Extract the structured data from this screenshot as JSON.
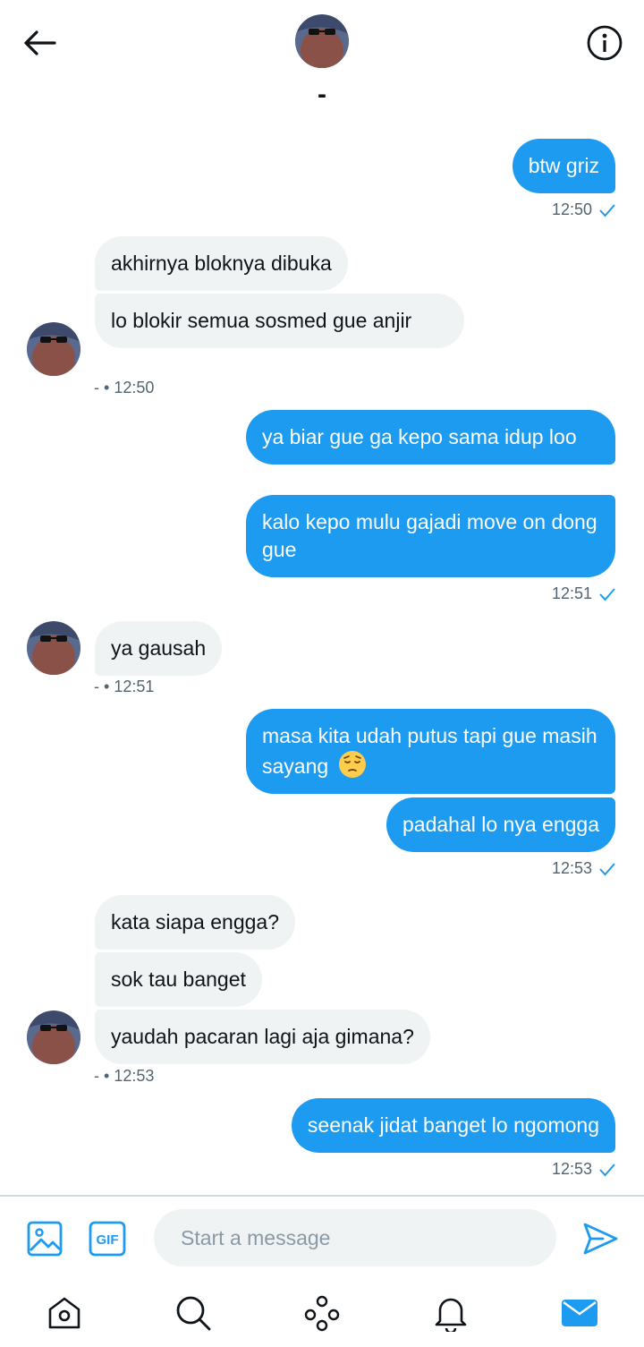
{
  "header": {
    "title": "-",
    "back_icon": "arrow-left-icon",
    "info_icon": "info-icon"
  },
  "colors": {
    "accent": "#1d9bf0",
    "incoming_bubble": "#eff3f4",
    "meta_text": "#536471"
  },
  "messages": [
    {
      "dir": "out",
      "text": "btw griz"
    },
    {
      "dir": "out_meta",
      "time": "12:50"
    },
    {
      "dir": "in",
      "text": "akhirnya bloknya dibuka"
    },
    {
      "dir": "in",
      "text": "lo blokir semua sosmed gue anjir"
    },
    {
      "dir": "in_meta",
      "sender": "-",
      "separator": "•",
      "time": "12:50"
    },
    {
      "dir": "out",
      "text": "ya biar gue ga kepo sama idup loo"
    },
    {
      "dir": "out",
      "text": "kalo kepo mulu gajadi move on dong gue"
    },
    {
      "dir": "out_meta",
      "time": "12:51"
    },
    {
      "dir": "in",
      "text": "ya gausah"
    },
    {
      "dir": "in_meta",
      "sender": "-",
      "separator": "•",
      "time": "12:51"
    },
    {
      "dir": "out",
      "text": "masa kita udah putus tapi gue masih sayang"
    },
    {
      "dir": "out",
      "text": "padahal lo nya engga"
    },
    {
      "dir": "out_meta",
      "time": "12:53"
    },
    {
      "dir": "in",
      "text": "kata siapa engga?"
    },
    {
      "dir": "in",
      "text": "sok tau banget"
    },
    {
      "dir": "in",
      "text": "yaudah pacaran lagi aja gimana?"
    },
    {
      "dir": "in_meta",
      "sender": "-",
      "separator": "•",
      "time": "12:53"
    },
    {
      "dir": "out",
      "text": "seenak jidat banget lo ngomong"
    },
    {
      "dir": "out_meta",
      "time": "12:53"
    }
  ],
  "compose": {
    "placeholder": "Start a message",
    "value": "",
    "gif_label": "GIF",
    "media_icon": "image-icon",
    "send_icon": "send-icon"
  },
  "bottom_nav": {
    "items": [
      {
        "icon": "home-icon",
        "active": false
      },
      {
        "icon": "search-icon",
        "active": false
      },
      {
        "icon": "spaces-icon",
        "active": false
      },
      {
        "icon": "bell-icon",
        "active": false
      },
      {
        "icon": "mail-icon",
        "active": true
      }
    ]
  }
}
